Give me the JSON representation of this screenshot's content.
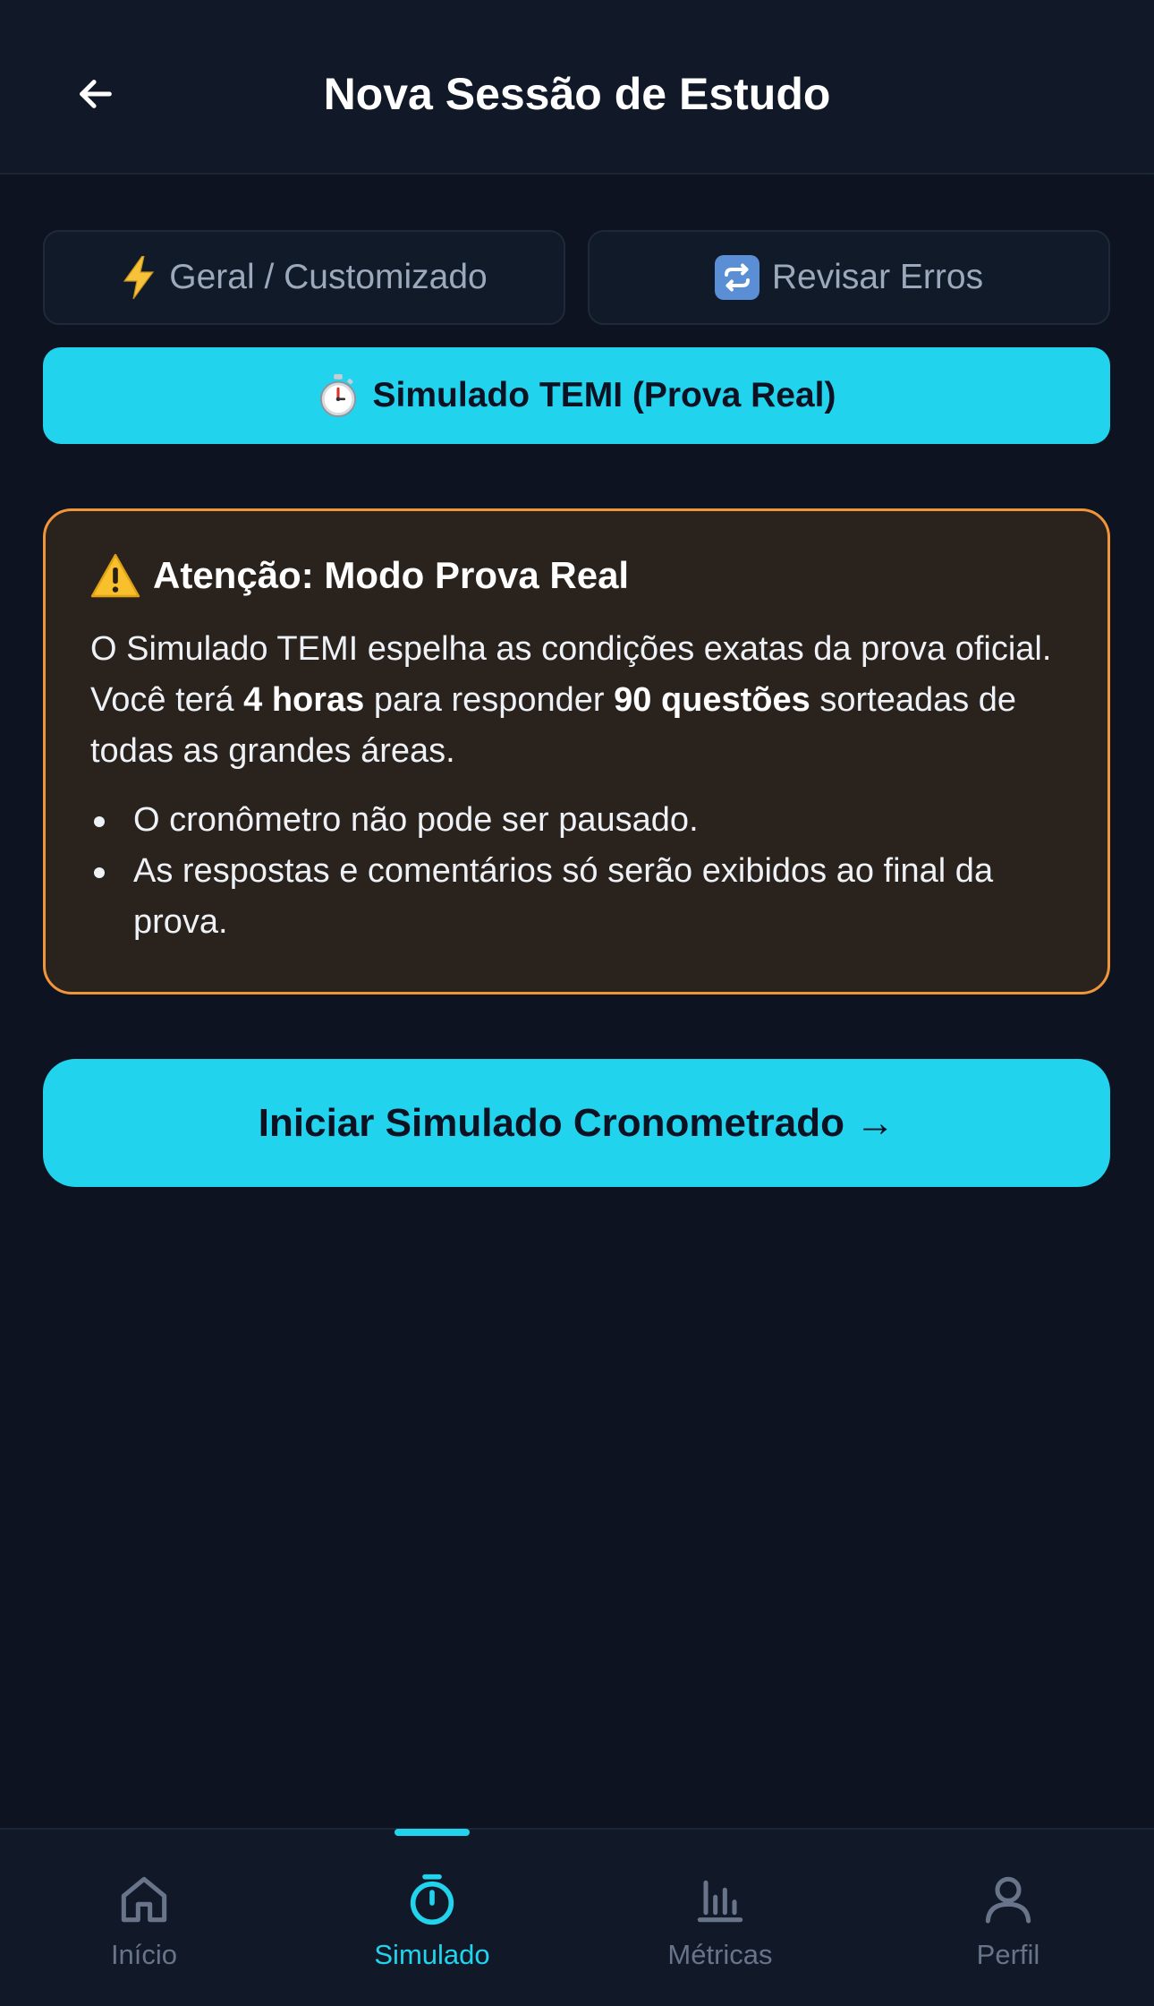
{
  "header": {
    "title": "Nova Sessão de Estudo"
  },
  "mode_tabs": {
    "general_label": "Geral / Customizado",
    "review_label": "Revisar Erros",
    "simulated_label": "Simulado TEMI (Prova Real)",
    "general_icon": "lightning-icon",
    "review_icon": "refresh-icon",
    "simulated_icon": "stopwatch-icon"
  },
  "warning": {
    "title": "Atenção: Modo Prova Real",
    "body_part1": "O Simulado TEMI espelha as condições exatas da prova oficial. Você terá ",
    "hours": "4 horas",
    "body_part2": " para responder ",
    "questions": "90 questões",
    "body_part3": " sorteadas de todas as grandes áreas.",
    "bullet_1": "O cronômetro não pode ser pausado.",
    "bullet_2": "As respostas e comentários só serão exibidos ao final da prova."
  },
  "start_button": {
    "label": "Iniciar Simulado Cronometrado →"
  },
  "bottom_nav": {
    "items": [
      {
        "label": "Início",
        "icon": "home-icon",
        "active": false
      },
      {
        "label": "Simulado",
        "icon": "timer-icon",
        "active": true
      },
      {
        "label": "Métricas",
        "icon": "bar-chart-icon",
        "active": false
      },
      {
        "label": "Perfil",
        "icon": "user-icon",
        "active": false
      }
    ]
  },
  "colors": {
    "background": "#0d1320",
    "accent": "#22d3ee",
    "warning_border": "#f0963a",
    "warning_bg": "#2a221d",
    "inactive": "#677489"
  }
}
